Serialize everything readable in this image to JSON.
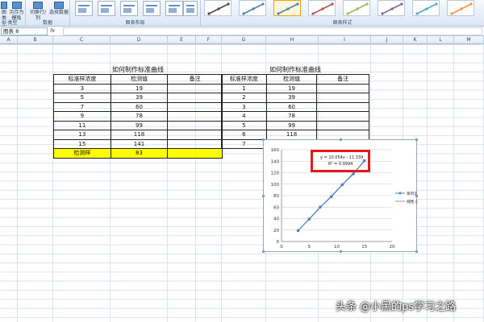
{
  "ribbon": {
    "type_group_label": "类型",
    "data_group_label": "数据",
    "layout_group_label": "图表布局",
    "style_group_label": "图表样式",
    "save_template_label_1": "另存为",
    "save_template_label_2": "模板",
    "change_type_label": "图类型",
    "switch_row_col_label": "切换行/列",
    "select_data_label": "选择数据",
    "style_colors": [
      "#4a4a4a",
      "#4f81bd",
      "#4f81bd",
      "#c0504d",
      "#9bbb59",
      "#8064a2",
      "#4bacc6",
      "#f79646"
    ]
  },
  "formula_bar": {
    "name_box": "图表 8",
    "fx": "fx"
  },
  "columns": [
    "A",
    "B",
    "C",
    "D",
    "E",
    "F",
    "G",
    "H",
    "I",
    "J",
    "K",
    "L",
    "M"
  ],
  "table1": {
    "title": "如何制作标准曲线",
    "headers": [
      "标准样浓度",
      "检测值",
      "备注"
    ],
    "rows": [
      [
        "3",
        "19",
        ""
      ],
      [
        "5",
        "39",
        ""
      ],
      [
        "7",
        "60",
        ""
      ],
      [
        "9",
        "78",
        ""
      ],
      [
        "11",
        "99",
        ""
      ],
      [
        "13",
        "118",
        ""
      ],
      [
        "15",
        "141",
        ""
      ]
    ],
    "sample_row": [
      "检测样",
      "83",
      ""
    ]
  },
  "table2": {
    "title": "如何制作标准曲线",
    "headers": [
      "标准样浓度",
      "检测值",
      "备注"
    ],
    "rows": [
      [
        "1",
        "19",
        ""
      ],
      [
        "2",
        "39",
        ""
      ],
      [
        "3",
        "60",
        ""
      ],
      [
        "4",
        "78",
        ""
      ],
      [
        "5",
        "99",
        ""
      ],
      [
        "6",
        "118",
        ""
      ],
      [
        "7",
        "",
        ""
      ]
    ]
  },
  "chart_data": {
    "type": "scatter",
    "x": [
      3,
      5,
      7,
      9,
      11,
      13,
      15
    ],
    "series": [
      {
        "name": "系列1",
        "values": [
          19,
          39,
          60,
          78,
          99,
          118,
          141
        ]
      }
    ],
    "trendline": {
      "name": "线性 (系列1)",
      "equation": "y = 10.054x - 11.339",
      "r2": "R² = 0.9994"
    },
    "xlim": [
      0,
      20
    ],
    "ylim": [
      0,
      160
    ],
    "xticks": [
      "0",
      "5",
      "10",
      "15",
      "20"
    ],
    "yticks": [
      "0",
      "20",
      "40",
      "60",
      "80",
      "100",
      "120",
      "140",
      "160"
    ],
    "grid": true,
    "legend_position": "right",
    "series_color": "#4f81bd"
  },
  "watermark": "头条 @小黑的ps学习之路"
}
